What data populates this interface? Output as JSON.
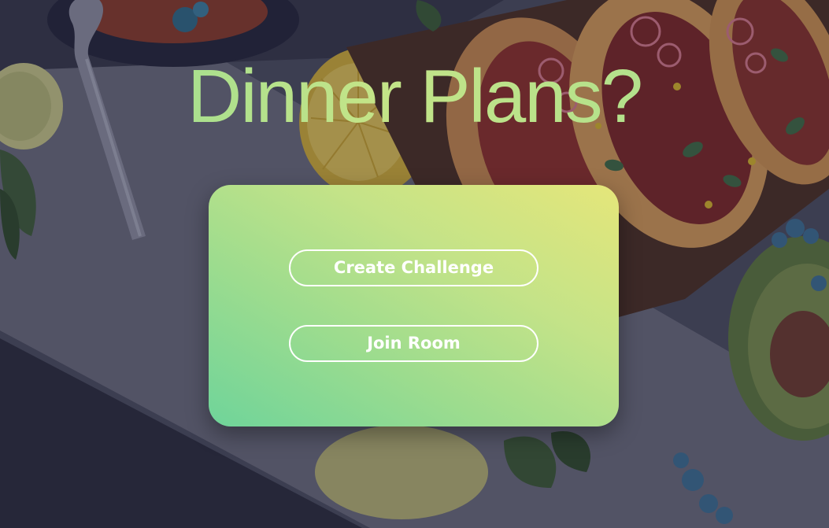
{
  "page": {
    "title": "Dinner Plans?"
  },
  "card": {
    "create_label": "Create Challenge",
    "join_label": "Join Room"
  },
  "colors": {
    "title_gradient": [
      "#8fdc94",
      "#c4e488",
      "#a8df8e"
    ],
    "card_gradient": [
      "#e5e67a",
      "#c4e388",
      "#9ddc8e",
      "#6fd49a"
    ],
    "button_border": "#ffffff",
    "background_dark": "#2f3247"
  }
}
